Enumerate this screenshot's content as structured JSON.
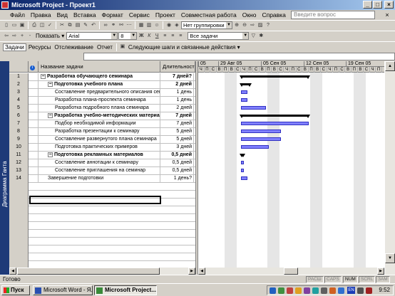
{
  "window": {
    "title": "Microsoft Project - Проект1",
    "minimize": "_",
    "maximize": "□",
    "close": "×"
  },
  "menu": {
    "items": [
      "Файл",
      "Правка",
      "Вид",
      "Вставка",
      "Формат",
      "Сервис",
      "Проект",
      "Совместная работа",
      "Окно",
      "Справка"
    ],
    "help_placeholder": "Введите вопрос",
    "doc_close": "×"
  },
  "toolbar1": {
    "grouping": "Нет группировки",
    "zoom_in": "+",
    "zoom_out": "-"
  },
  "toolbar2": {
    "show_label": "Показать",
    "font": "Arial",
    "size": "8",
    "bold": "Ж",
    "italic": "К",
    "underline": "Ч",
    "filter": "Все задачи"
  },
  "toolbar3": {
    "items": [
      "Задачи",
      "Ресурсы",
      "Отслеживание",
      "Отчет"
    ],
    "next_steps": "Следующие шаги и связанные действия"
  },
  "view_bar": {
    "label": "Диаграмма Ганта"
  },
  "grid": {
    "header_name": "Название задачи",
    "header_duration": "Длительность",
    "rows": [
      {
        "id": "1",
        "name": "Разработка обучающего семинара",
        "duration": "7 дней?",
        "level": 0,
        "summary": true,
        "collapse": "−"
      },
      {
        "id": "2",
        "name": "Подготовка учебного плана",
        "duration": "2 дней",
        "level": 1,
        "summary": true,
        "collapse": "−"
      },
      {
        "id": "3",
        "name": "Составление предварительного описания семи",
        "duration": "1 день",
        "level": 2,
        "summary": false
      },
      {
        "id": "4",
        "name": "Разработка плана-проспекта семинара",
        "duration": "1 день",
        "level": 2,
        "summary": false
      },
      {
        "id": "5",
        "name": "Разработка подробного плана семинара",
        "duration": "2 дней",
        "level": 2,
        "summary": false
      },
      {
        "id": "6",
        "name": "Разработка учебно-методических материало",
        "duration": "7 дней",
        "level": 1,
        "summary": true,
        "collapse": "−"
      },
      {
        "id": "7",
        "name": "Подбор необходимой информации",
        "duration": "7 дней",
        "level": 2,
        "summary": false
      },
      {
        "id": "8",
        "name": "Разработка презентации к семинару",
        "duration": "5 дней",
        "level": 2,
        "summary": false
      },
      {
        "id": "9",
        "name": "Составление  развернутого плана семинара",
        "duration": "5 дней",
        "level": 2,
        "summary": false
      },
      {
        "id": "10",
        "name": "Подготовка практических примеров",
        "duration": "3 дней",
        "level": 2,
        "summary": false
      },
      {
        "id": "11",
        "name": "Подготовка рекламных материалов",
        "duration": "0,5 дней",
        "level": 1,
        "summary": true,
        "collapse": "−"
      },
      {
        "id": "12",
        "name": "Составление аннотации к семинару",
        "duration": "0,5 дней",
        "level": 2,
        "summary": false
      },
      {
        "id": "13",
        "name": "Составление приглашения на семинар",
        "duration": "0,5 дней",
        "level": 2,
        "summary": false
      },
      {
        "id": "14",
        "name": "Завершение подготовки",
        "duration": "1 день?",
        "level": 1,
        "summary": false
      }
    ]
  },
  "gantt": {
    "weeks": [
      "05",
      "29 Авг 05",
      "05 Сен 05",
      "12 Сен 05",
      "19 Сен 05"
    ],
    "days": [
      "Ч",
      "П",
      "С",
      "В",
      "П",
      "В",
      "С",
      "Ч",
      "П",
      "С",
      "В",
      "П",
      "В",
      "С",
      "Ч",
      "П",
      "С",
      "В",
      "П",
      "В",
      "С",
      "Ч",
      "П",
      "С",
      "В",
      "П",
      "В",
      "С",
      "Ч",
      "П"
    ],
    "bars": [
      {
        "row": 1,
        "type": "summary",
        "start_day": 7.0,
        "length": 11.0
      },
      {
        "row": 2,
        "type": "summary",
        "start_day": 7.0,
        "length": 1.5
      },
      {
        "row": 3,
        "type": "task",
        "start_day": 7.0,
        "length": 1.0
      },
      {
        "row": 4,
        "type": "task",
        "start_day": 7.0,
        "length": 1.0
      },
      {
        "row": 5,
        "type": "task",
        "start_day": 7.0,
        "length": 4.0
      },
      {
        "row": 6,
        "type": "summary",
        "start_day": 7.0,
        "length": 11.0
      },
      {
        "row": 7,
        "type": "task",
        "start_day": 7.0,
        "length": 11.0
      },
      {
        "row": 8,
        "type": "task",
        "start_day": 7.0,
        "length": 6.5
      },
      {
        "row": 9,
        "type": "task",
        "start_day": 7.0,
        "length": 6.5
      },
      {
        "row": 10,
        "type": "task",
        "start_day": 7.0,
        "length": 4.5
      },
      {
        "row": 11,
        "type": "summary",
        "start_day": 7.0,
        "length": 0.5
      },
      {
        "row": 12,
        "type": "task",
        "start_day": 7.0,
        "length": 0.5
      },
      {
        "row": 13,
        "type": "task",
        "start_day": 7.0,
        "length": 0.5
      },
      {
        "row": 14,
        "type": "task",
        "start_day": 7.0,
        "length": 1.0
      }
    ]
  },
  "status": {
    "text": "Готово",
    "indicators": [
      {
        "label": "РАСШ",
        "on": false
      },
      {
        "label": "CAPS",
        "on": false
      },
      {
        "label": "NUM",
        "on": true
      },
      {
        "label": "SCRL",
        "on": false
      },
      {
        "label": "ЗАМ",
        "on": false
      }
    ]
  },
  "taskbar": {
    "start": "Пуск",
    "tasks": [
      "Microsoft Word - Я...",
      "Microsoft Project..."
    ],
    "lang": "EN",
    "clock": "9:52"
  }
}
